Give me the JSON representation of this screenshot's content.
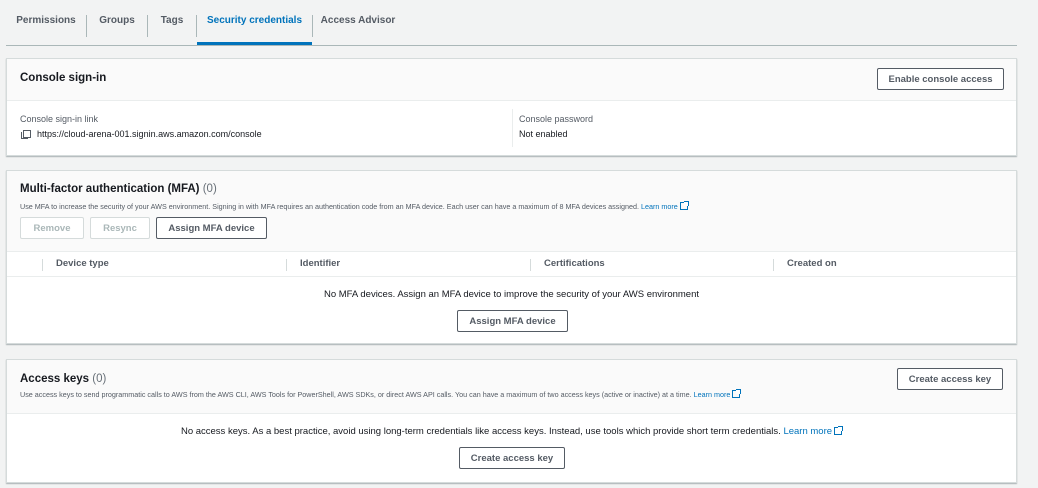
{
  "tabs": [
    {
      "label": "Permissions"
    },
    {
      "label": "Groups"
    },
    {
      "label": "Tags"
    },
    {
      "label": "Security credentials"
    },
    {
      "label": "Access Advisor"
    }
  ],
  "console": {
    "title": "Console sign-in",
    "enable_button": "Enable console access",
    "link_label": "Console sign-in link",
    "link_value": "https://cloud-arena-001.signin.aws.amazon.com/console",
    "password_label": "Console password",
    "password_value": "Not enabled"
  },
  "mfa": {
    "title": "Multi-factor authentication (MFA)",
    "count": "(0)",
    "description": "Use MFA to increase the security of your AWS environment. Signing in with MFA requires an authentication code from an MFA device. Each user can have a maximum of 8 MFA devices assigned.",
    "learn_more": "Learn more",
    "remove_button": "Remove",
    "resync_button": "Resync",
    "assign_button": "Assign MFA device",
    "columns": [
      "Device type",
      "Identifier",
      "Certifications",
      "Created on"
    ],
    "empty_message": "No MFA devices. Assign an MFA device to improve the security of your AWS environment",
    "empty_assign_button": "Assign MFA device"
  },
  "access_keys": {
    "title": "Access keys",
    "count": "(0)",
    "description": "Use access keys to send programmatic calls to AWS from the AWS CLI, AWS Tools for PowerShell, AWS SDKs, or direct AWS API calls. You can have a maximum of two access keys (active or inactive) at a time.",
    "learn_more": "Learn more",
    "create_button": "Create access key",
    "empty_message": "No access keys. As a best practice, avoid using long-term credentials like access keys. Instead, use tools which provide short term credentials.",
    "empty_learn_more": "Learn more",
    "empty_create_button": "Create access key"
  }
}
